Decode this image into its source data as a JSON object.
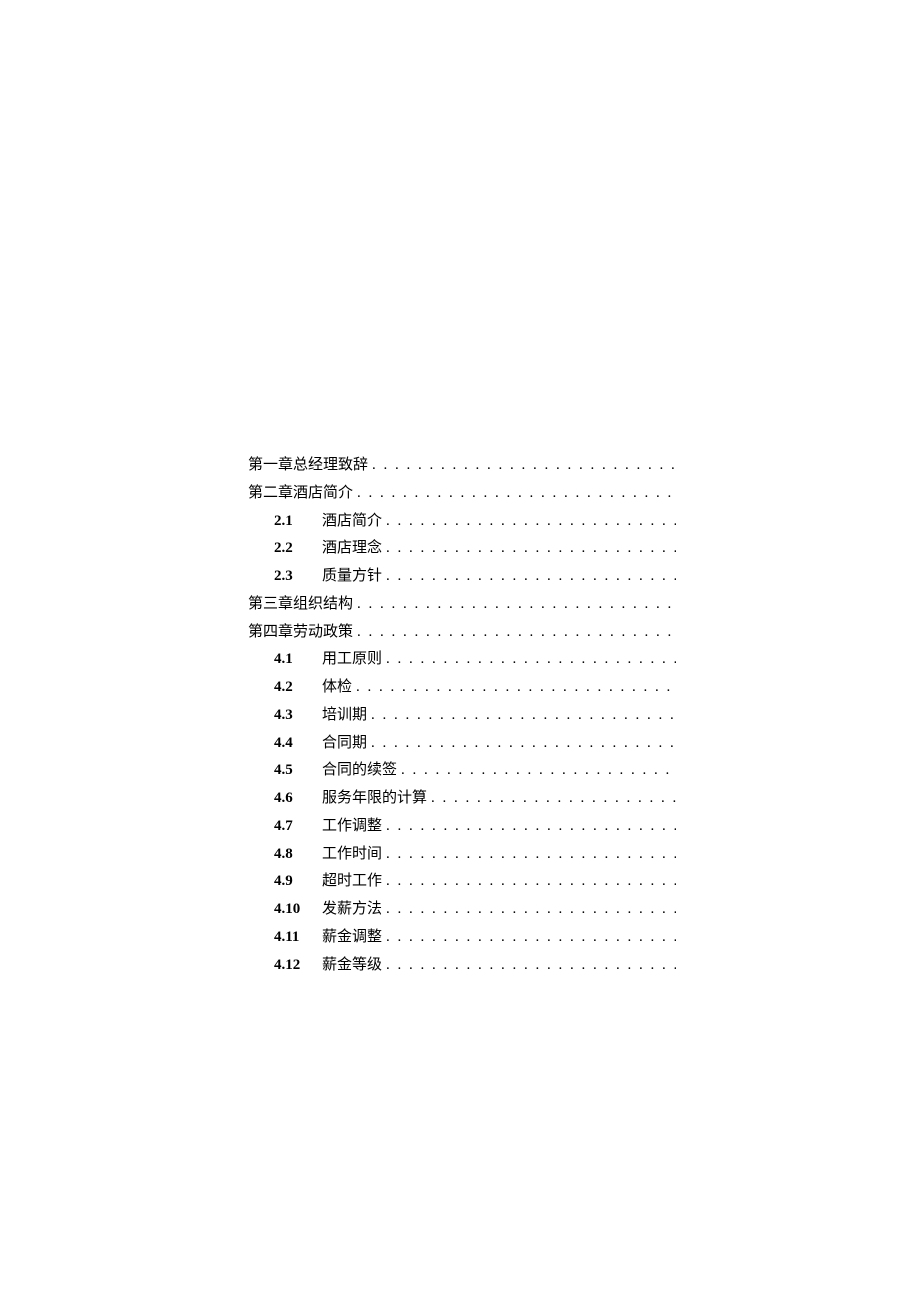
{
  "toc": [
    {
      "type": "chapter",
      "num": "",
      "title": "第一章总经理致辞"
    },
    {
      "type": "chapter",
      "num": "",
      "title": "第二章酒店简介"
    },
    {
      "type": "subsection",
      "num": "2.1",
      "title": "酒店简介"
    },
    {
      "type": "subsection",
      "num": "2.2",
      "title": "酒店理念"
    },
    {
      "type": "subsection",
      "num": "2.3",
      "title": "质量方针"
    },
    {
      "type": "chapter",
      "num": "",
      "title": "第三章组织结构"
    },
    {
      "type": "chapter",
      "num": "",
      "title": "第四章劳动政策"
    },
    {
      "type": "subsection",
      "num": "4.1",
      "title": "用工原则"
    },
    {
      "type": "subsection",
      "num": "4.2",
      "title": "体检"
    },
    {
      "type": "subsection",
      "num": "4.3",
      "title": "培训期"
    },
    {
      "type": "subsection",
      "num": "4.4",
      "title": "合同期"
    },
    {
      "type": "subsection",
      "num": "4.5",
      "title": "合同的续签"
    },
    {
      "type": "subsection",
      "num": "4.6",
      "title": "服务年限的计算"
    },
    {
      "type": "subsection",
      "num": "4.7",
      "title": "工作调整"
    },
    {
      "type": "subsection",
      "num": "4.8",
      "title": "工作时间"
    },
    {
      "type": "subsection",
      "num": "4.9",
      "title": "超时工作"
    },
    {
      "type": "subsection",
      "num": "4.10",
      "title": "发薪方法"
    },
    {
      "type": "subsection",
      "num": "4.11",
      "title": "薪金调整"
    },
    {
      "type": "subsection",
      "num": "4.12",
      "title": "薪金等级"
    }
  ]
}
